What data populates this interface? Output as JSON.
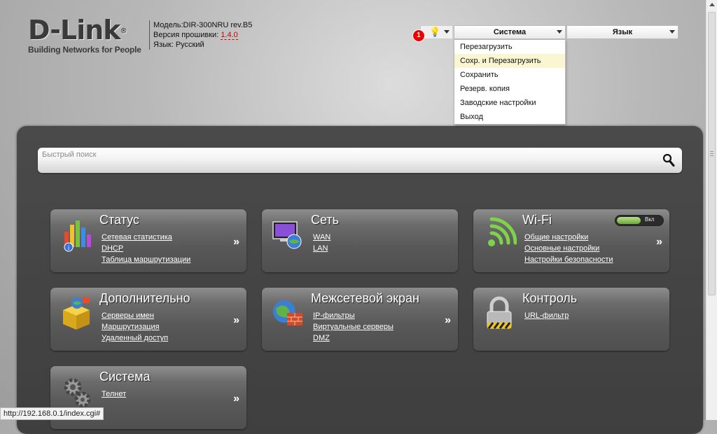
{
  "header": {
    "logo": "D-Link",
    "logo_reg": "®",
    "tagline": "Building Networks for People",
    "model_label": "Модель:",
    "model_value": "DIR-300NRU rev.B5",
    "firmware_label": "Версия прошивки:",
    "firmware_value": "1.4.0",
    "lang_label": "Язык:",
    "lang_value": "Русский"
  },
  "topmenu": {
    "notification_count": "1",
    "system_label": "Система",
    "language_label": "Язык"
  },
  "system_dropdown": {
    "items": [
      {
        "label": "Перезагрузить"
      },
      {
        "label": "Сохр. и Перезагрузить"
      },
      {
        "label": "Сохранить"
      },
      {
        "label": "Резерв. копия"
      },
      {
        "label": "Заводские настройки"
      },
      {
        "label": "Выход"
      }
    ]
  },
  "search": {
    "placeholder": "Быстрый поиск"
  },
  "cards": [
    {
      "title": "Статус",
      "links": [
        "Сетевая статистика",
        "DHCP",
        "Таблица маршрутизации"
      ],
      "icon": "status-chart-icon"
    },
    {
      "title": "Сеть",
      "links": [
        "WAN",
        "LAN"
      ],
      "icon": "network-icon"
    },
    {
      "title": "Wi-Fi",
      "links": [
        "Общие настройки",
        "Основные настройки",
        "Настройки безопасности"
      ],
      "icon": "wifi-icon",
      "toggle_label": "Вкл"
    },
    {
      "title": "Дополнительно",
      "links": [
        "Серверы имен",
        "Маршрутизация",
        "Удаленный доступ"
      ],
      "icon": "box-icon"
    },
    {
      "title": "Межсетевой экран",
      "links": [
        "IP-фильтры",
        "Виртуальные серверы",
        "DMZ"
      ],
      "icon": "firewall-icon"
    },
    {
      "title": "Контроль",
      "links": [
        "URL-фильтр"
      ],
      "icon": "lock-icon"
    },
    {
      "title": "Система",
      "links": [
        "Телнет"
      ],
      "icon": "gears-icon"
    }
  ],
  "more_symbol": "»",
  "statusbar": {
    "url": "http://192.168.0.1/index.cgi#"
  },
  "colors": {
    "accent_red": "#cc0000",
    "panel_dark": "#444444",
    "highlight": "#fbf6d2"
  }
}
